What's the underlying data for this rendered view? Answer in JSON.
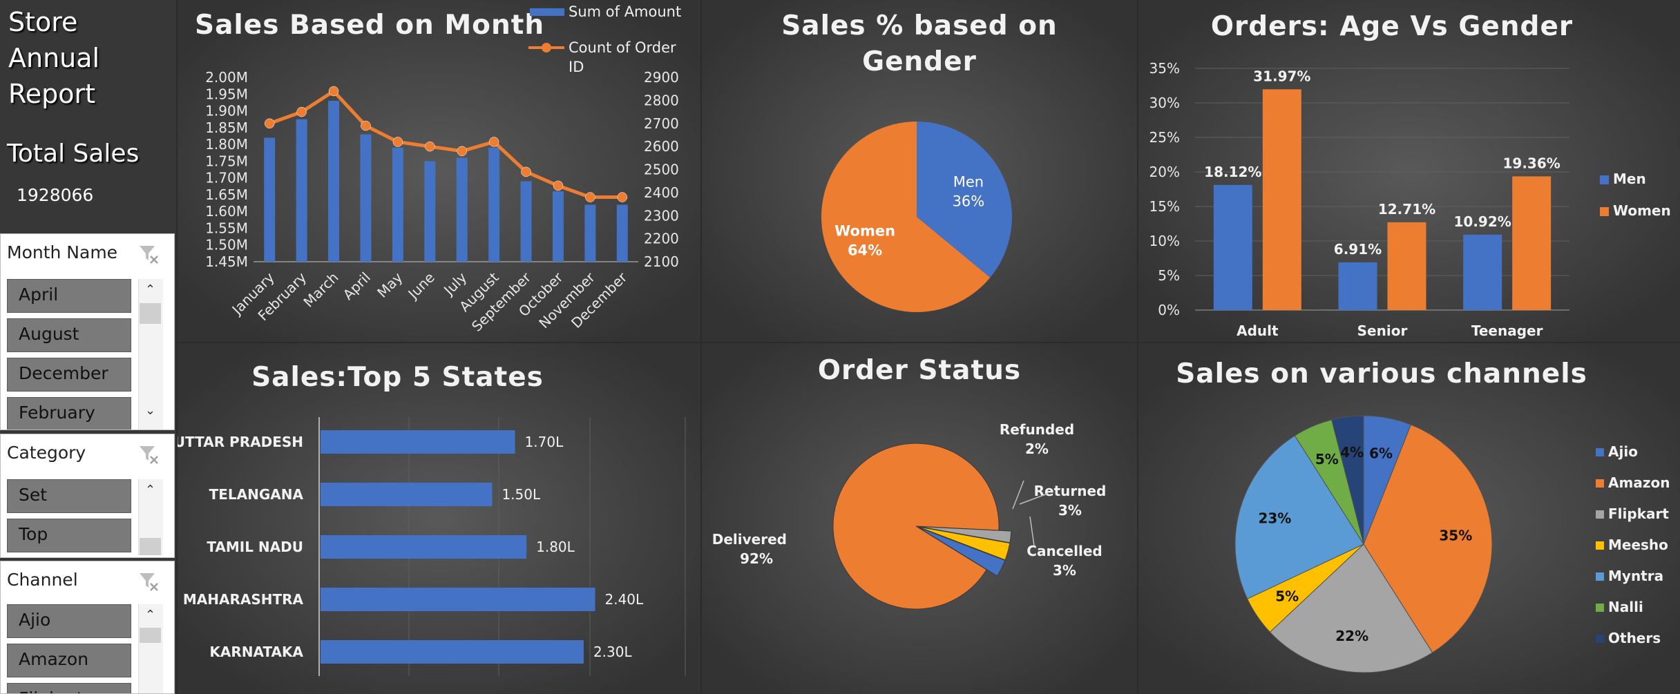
{
  "sidebar": {
    "title_lines": [
      "Store",
      "Annual",
      "Report"
    ],
    "total_sales_label": "Total Sales",
    "total_sales_value": "1928066",
    "slicers": [
      {
        "title": "Month Name",
        "items": [
          "April",
          "August",
          "December",
          "February"
        ]
      },
      {
        "title": "Category",
        "items": [
          "Set",
          "Top"
        ]
      },
      {
        "title": "Channel",
        "items": [
          "Ajio",
          "Amazon",
          "Flipkart"
        ]
      }
    ]
  },
  "colors": {
    "blue": "#4472c4",
    "orange": "#ed7d31",
    "gray": "#a5a5a5",
    "yellow": "#ffc000",
    "lightblue": "#5b9bd5",
    "green": "#70ad47",
    "navy": "#264478"
  },
  "charts": {
    "month": {
      "title": "Sales Based on Month",
      "legend": [
        "Sum of Amount",
        "Count of Order ID"
      ],
      "chart_data": {
        "type": "bar",
        "categories": [
          "January",
          "February",
          "March",
          "April",
          "May",
          "June",
          "July",
          "August",
          "September",
          "October",
          "November",
          "December"
        ],
        "series": [
          {
            "name": "Sum of Amount",
            "type": "bar",
            "axis": "left",
            "values": [
              1.82,
              1.875,
              1.93,
              1.83,
              1.79,
              1.75,
              1.76,
              1.79,
              1.69,
              1.66,
              1.62,
              1.62
            ]
          },
          {
            "name": "Count of Order ID",
            "type": "line",
            "axis": "right",
            "values": [
              2700,
              2750,
              2840,
              2690,
              2620,
              2600,
              2580,
              2620,
              2490,
              2430,
              2380,
              2380
            ]
          }
        ],
        "y_left_ticks": [
          "2.00M",
          "1.95M",
          "1.90M",
          "1.85M",
          "1.80M",
          "1.75M",
          "1.70M",
          "1.65M",
          "1.60M",
          "1.55M",
          "1.50M",
          "1.45M"
        ],
        "y_right_ticks": [
          "2900",
          "2800",
          "2700",
          "2600",
          "2500",
          "2400",
          "2300",
          "2200",
          "2100"
        ],
        "ylim_left": [
          1.45,
          2.0
        ],
        "ylim_right": [
          2100,
          2900
        ]
      }
    },
    "gender": {
      "title_lines": [
        "Sales % based on",
        "Gender"
      ],
      "chart_data": {
        "type": "pie",
        "slices": [
          {
            "label": "Men",
            "value": 36,
            "text": "36%",
            "color": "#4472c4"
          },
          {
            "label": "Women",
            "value": 64,
            "text": "64%",
            "color": "#ed7d31"
          }
        ]
      }
    },
    "agegender": {
      "title": "Orders: Age Vs Gender",
      "chart_data": {
        "type": "bar",
        "categories": [
          "Adult",
          "Senior",
          "Teenager"
        ],
        "series": [
          {
            "name": "Men",
            "values": [
              18.12,
              6.91,
              10.92
            ],
            "labels": [
              "18.12%",
              "6.91%",
              "10.92%"
            ]
          },
          {
            "name": "Women",
            "values": [
              31.97,
              12.71,
              19.36
            ],
            "labels": [
              "31.97%",
              "12.71%",
              "19.36%"
            ]
          }
        ],
        "y_ticks": [
          "35%",
          "30%",
          "25%",
          "20%",
          "15%",
          "10%",
          "5%",
          "0%"
        ],
        "ylim": [
          0,
          35
        ]
      }
    },
    "states": {
      "title": "Sales:Top 5 States",
      "chart_data": {
        "type": "bar",
        "orientation": "horizontal",
        "categories": [
          "UTTAR PRADESH",
          "TELANGANA",
          "TAMIL NADU",
          "MAHARASHTRA",
          "KARNATAKA"
        ],
        "values": [
          1.7,
          1.5,
          1.8,
          2.4,
          2.3
        ],
        "labels": [
          "1.70L",
          "1.50L",
          "1.80L",
          "2.40L",
          "2.30L"
        ],
        "xlim": [
          0,
          3.2
        ]
      }
    },
    "status": {
      "title": "Order Status",
      "chart_data": {
        "type": "pie",
        "slices": [
          {
            "label": "Delivered",
            "value": 92,
            "text": "92%",
            "color": "#ed7d31"
          },
          {
            "label": "Cancelled",
            "value": 3,
            "text": "3%",
            "color": "#4472c4"
          },
          {
            "label": "Returned",
            "value": 3,
            "text": "3%",
            "color": "#ffc000"
          },
          {
            "label": "Refunded",
            "value": 2,
            "text": "2%",
            "color": "#a5a5a5"
          }
        ]
      }
    },
    "channels": {
      "title": "Sales on various channels",
      "chart_data": {
        "type": "pie",
        "slices": [
          {
            "label": "Ajio",
            "value": 6,
            "text": "6%",
            "color": "#4472c4"
          },
          {
            "label": "Amazon",
            "value": 35,
            "text": "35%",
            "color": "#ed7d31"
          },
          {
            "label": "Flipkart",
            "value": 22,
            "text": "22%",
            "color": "#a5a5a5"
          },
          {
            "label": "Meesho",
            "value": 5,
            "text": "5%",
            "color": "#ffc000"
          },
          {
            "label": "Myntra",
            "value": 23,
            "text": "23%",
            "color": "#5b9bd5"
          },
          {
            "label": "Nalli",
            "value": 5,
            "text": "5%",
            "color": "#70ad47"
          },
          {
            "label": "Others",
            "value": 4,
            "text": "4%",
            "color": "#264478"
          }
        ]
      }
    }
  }
}
